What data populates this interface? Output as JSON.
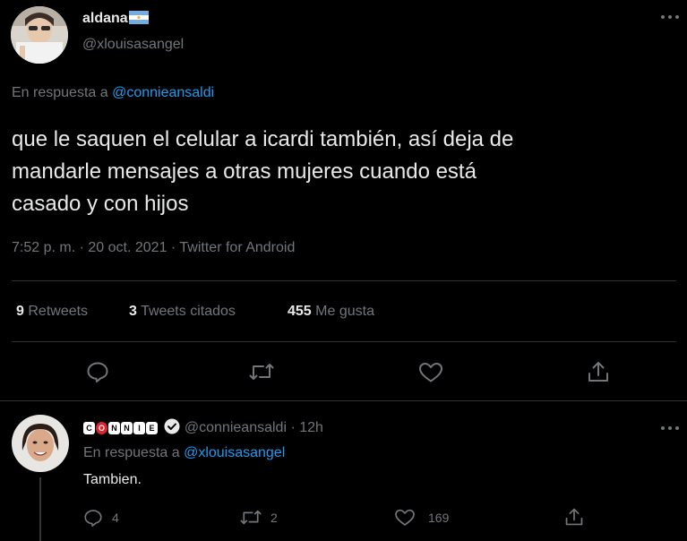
{
  "tweet": {
    "author_name": "aldana",
    "author_flag": "Argentina flag",
    "author_handle": "@xlouisasangel",
    "reply_prefix": "En respuesta a",
    "reply_to": "@connieansaldi",
    "text_line1": "que le saquen el celular a icardi también, así deja de",
    "text_line2": "mandarle mensajes a otras mujeres cuando está",
    "text_line3": "casado y con hijos",
    "time": "7:52 p. m.",
    "sep1": "·",
    "date": "20 oct. 2021",
    "sep2": "·",
    "source": "Twitter for Android",
    "retweets_count": "9",
    "retweets_label": "Retweets",
    "quotes_count": "3",
    "quotes_label": "Tweets citados",
    "likes_count": "455",
    "likes_label": "Me gusta"
  },
  "reply": {
    "name_letters": [
      "C",
      "O",
      "N",
      "N",
      "I",
      "E"
    ],
    "handle": "@connieansaldi",
    "sep": "·",
    "age": "12h",
    "reply_prefix": "En respuesta a",
    "reply_to": "@xlouisasangel",
    "text": "Tambien.",
    "reply_count": "4",
    "retweet_count": "2",
    "like_count": "169"
  },
  "icons": {
    "more": "more-horizontal-icon",
    "reply": "reply-bubble-icon",
    "retweet": "retweet-icon",
    "like": "heart-icon",
    "share": "share-icon",
    "verified": "verified-badge-icon"
  },
  "colors": {
    "background": "#000000",
    "text": "#e7e9ea",
    "muted": "#71767b",
    "link": "#1d9bf0",
    "divider": "#2f3336"
  }
}
